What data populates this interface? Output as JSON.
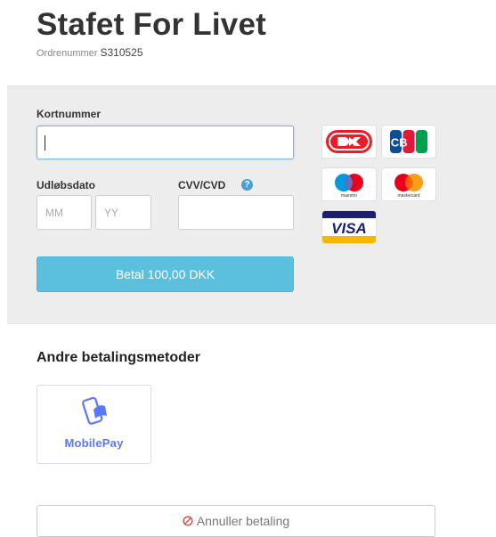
{
  "header": {
    "title": "Stafet For Livet",
    "order_label": "Ordrenummer",
    "order_number": "S310525"
  },
  "card_form": {
    "card_number_label": "Kortnummer",
    "card_number_value": "",
    "expiry_label": "Udløbsdato",
    "expiry_month_placeholder": "MM",
    "expiry_year_placeholder": "YY",
    "cvv_label": "CVV/CVD",
    "cvv_help_glyph": "?",
    "cvv_value": "",
    "pay_button_label": "Betal 100,00 DKK"
  },
  "card_logos": [
    {
      "name": "dankort-icon"
    },
    {
      "name": "jcb-icon",
      "text": "JCB"
    },
    {
      "name": "maestro-icon",
      "text": "maestro"
    },
    {
      "name": "mastercard-icon",
      "text": "mastercard"
    },
    {
      "name": "visa-icon",
      "text": "VISA"
    }
  ],
  "other_methods": {
    "heading": "Andre betalingsmetoder",
    "mobilepay_label": "MobilePay"
  },
  "cancel": {
    "label": "Annuller betaling",
    "icon": "ban-icon"
  },
  "colors": {
    "pay_button": "#5bc0de",
    "panel_bg": "#ededed",
    "mobilepay": "#5a78ff",
    "cancel_icon": "#d9534f",
    "visa_blue": "#1a1f71",
    "visa_gold": "#f7b600",
    "mc_red": "#eb001b",
    "mc_orange": "#f79e1b",
    "maestro_blue": "#0099df"
  }
}
